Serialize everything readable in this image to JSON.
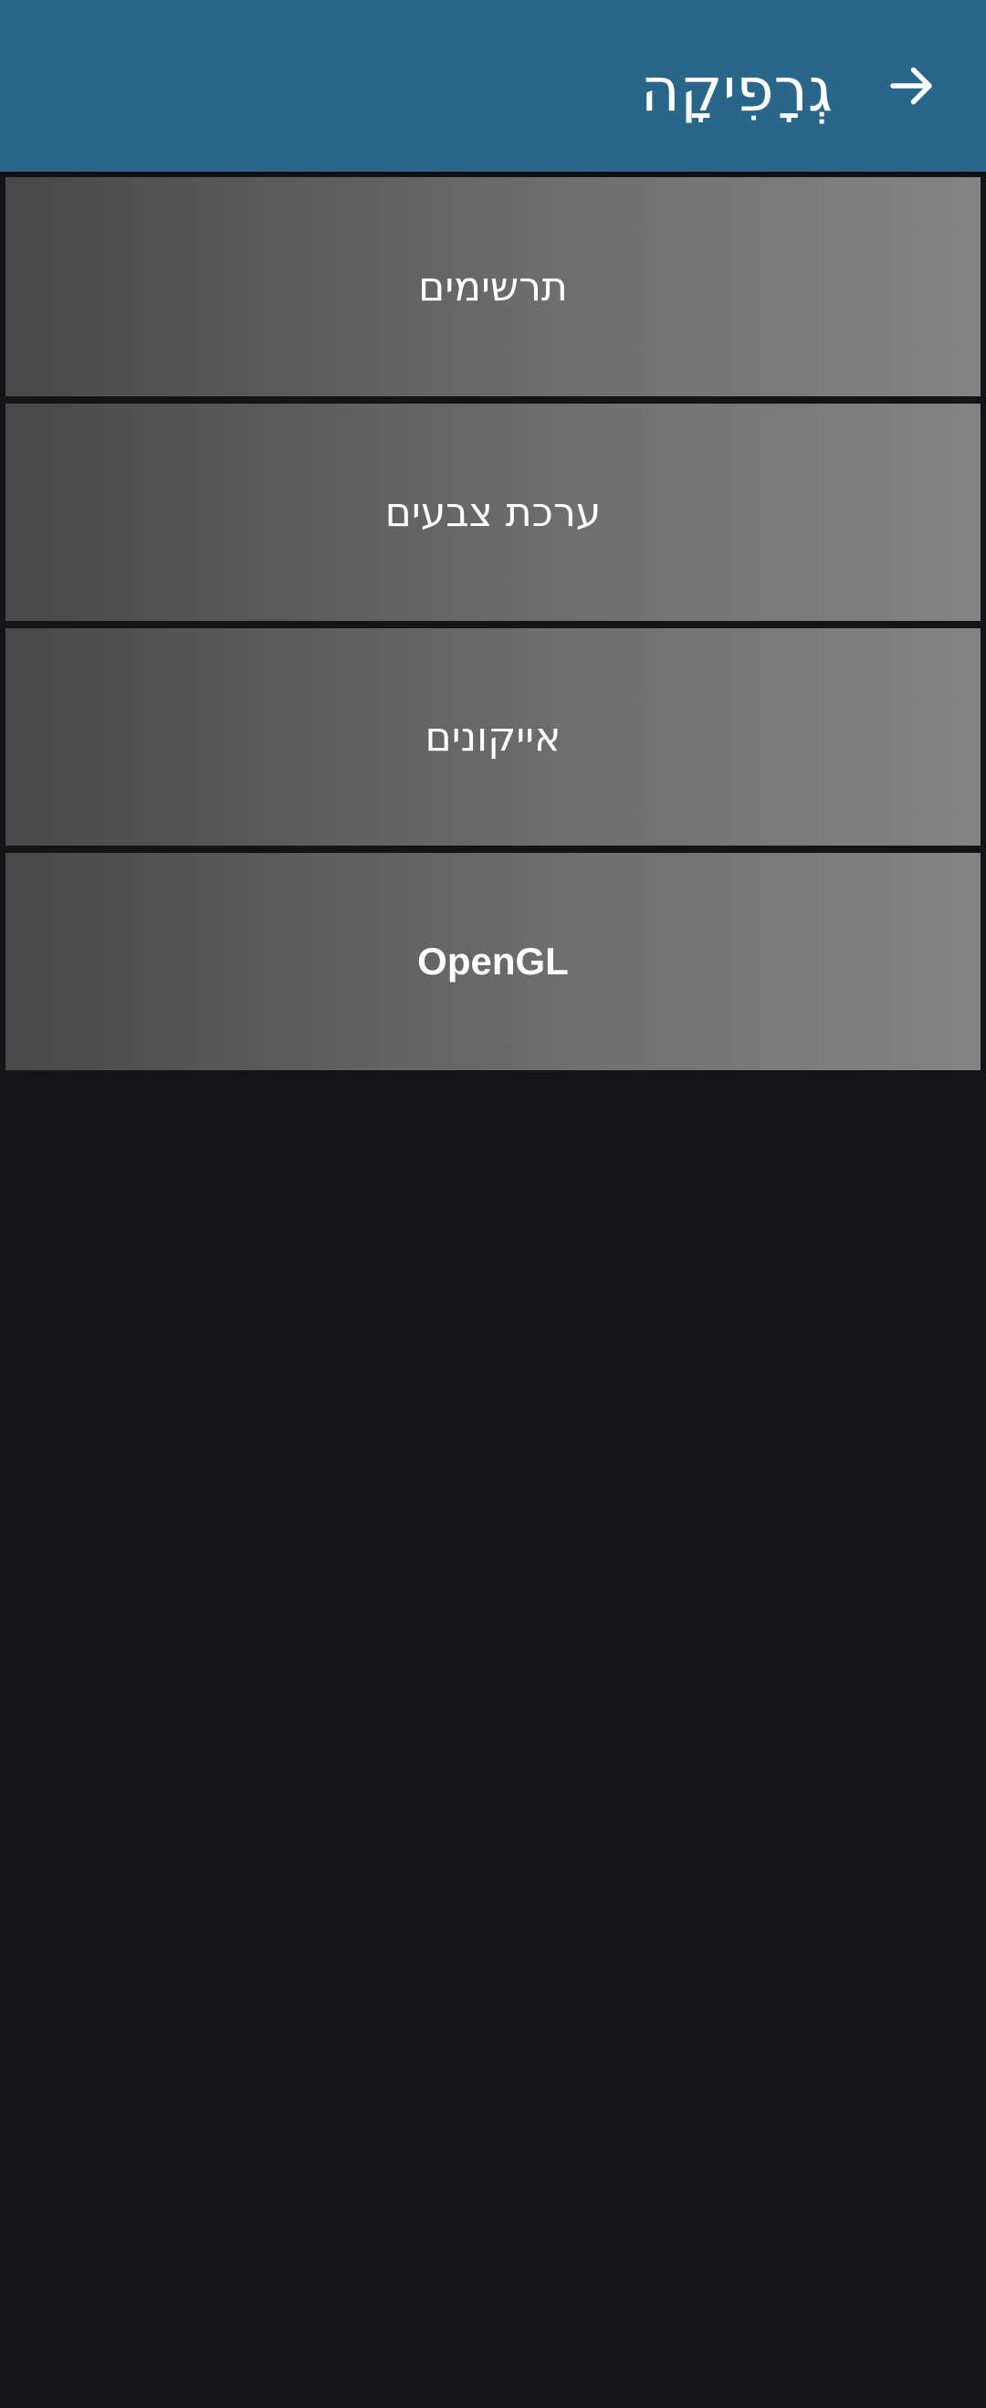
{
  "app_bar": {
    "title": "גְרָפִיקָה",
    "back_icon": "arrow-right-icon",
    "background_color": "#28668a"
  },
  "menu": {
    "items": [
      {
        "label": "תרשימים"
      },
      {
        "label": "ערכת צבעים"
      },
      {
        "label": "אייקונים"
      },
      {
        "label": "OpenGL"
      }
    ]
  },
  "colors": {
    "page_background": "#141318",
    "item_gradient_start": "#484848",
    "item_gradient_end": "#848484",
    "text": "#ffffff"
  }
}
